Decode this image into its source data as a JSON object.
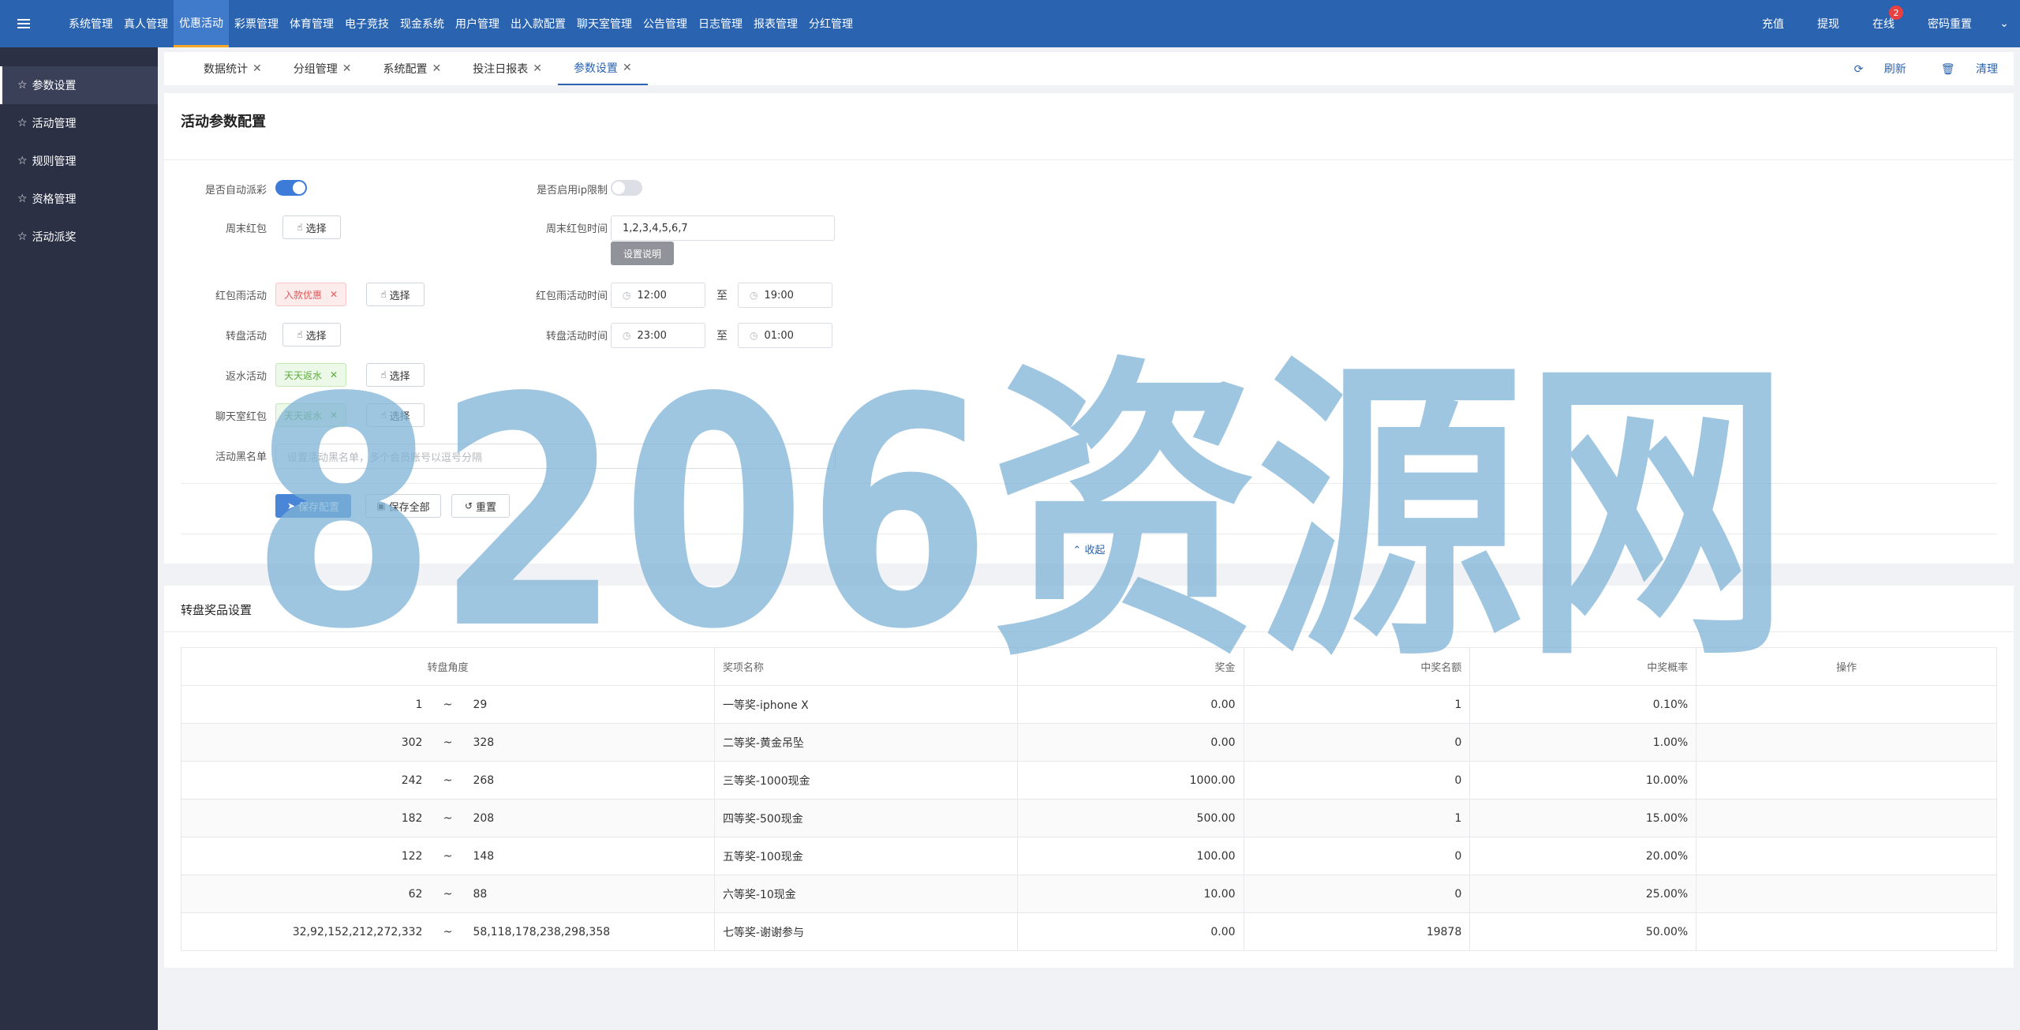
{
  "top_nav": {
    "items": [
      "系统管理",
      "真人管理",
      "优惠活动",
      "彩票管理",
      "体育管理",
      "电子竞技",
      "现金系统",
      "用户管理",
      "出入款配置",
      "聊天室管理",
      "公告管理",
      "日志管理",
      "报表管理",
      "分红管理"
    ],
    "active_index": 2,
    "right_items": {
      "recharge": "充值",
      "withdraw": "提现",
      "online": "在线",
      "online_badge": "2",
      "reset_password": "密码重置"
    }
  },
  "sidebar": {
    "items": [
      "参数设置",
      "活动管理",
      "规则管理",
      "资格管理",
      "活动派奖"
    ],
    "active_index": 0
  },
  "tabs": {
    "items": [
      "数据统计",
      "分组管理",
      "系统配置",
      "投注日报表",
      "参数设置"
    ],
    "active_index": 4,
    "refresh": "刷新",
    "clear": "清理"
  },
  "config": {
    "title": "活动参数配置",
    "auto_award_label": "是否自动派彩",
    "auto_award_on": true,
    "ip_limit_label": "是否启用ip限制",
    "ip_limit_on": false,
    "weekend_label": "周末红包",
    "select_label": "选择",
    "weekend_time_label": "周末红包时间",
    "weekend_time_value": "1,2,3,4,5,6,7",
    "setting_note": "设置说明",
    "rain_label": "红包雨活动",
    "rain_tag": "入款优惠",
    "rain_time_label": "红包雨活动时间",
    "rain_start": "12:00",
    "rain_end": "19:00",
    "to_label": "至",
    "wheel_label": "转盘活动",
    "wheel_time_label": "转盘活动时间",
    "wheel_start": "23:00",
    "wheel_end": "01:00",
    "rebate_label": "返水活动",
    "rebate_tag": "天天返水",
    "chat_label": "聊天室红包",
    "chat_tag": "天天返水",
    "blacklist_label": "活动黑名单",
    "blacklist_placeholder": "设置活动黑名单，多个会员账号以逗号分隔",
    "save_config": "保存配置",
    "save_all": "保存全部",
    "reset": "重置",
    "collapse": "收起"
  },
  "prize": {
    "title": "转盘奖品设置",
    "headers": [
      "转盘角度",
      "奖项名称",
      "奖金",
      "中奖名额",
      "中奖概率",
      "操作"
    ],
    "rows": [
      {
        "angle_from": "1",
        "angle_sep": "~",
        "angle_to": "29",
        "name": "一等奖-iphone X",
        "amount": "0.00",
        "count": "1",
        "rate": "0.10%"
      },
      {
        "angle_from": "302",
        "angle_sep": "~",
        "angle_to": "328",
        "name": "二等奖-黄金吊坠",
        "amount": "0.00",
        "count": "0",
        "rate": "1.00%"
      },
      {
        "angle_from": "242",
        "angle_sep": "~",
        "angle_to": "268",
        "name": "三等奖-1000现金",
        "amount": "1000.00",
        "count": "0",
        "rate": "10.00%"
      },
      {
        "angle_from": "182",
        "angle_sep": "~",
        "angle_to": "208",
        "name": "四等奖-500现金",
        "amount": "500.00",
        "count": "1",
        "rate": "15.00%"
      },
      {
        "angle_from": "122",
        "angle_sep": "~",
        "angle_to": "148",
        "name": "五等奖-100现金",
        "amount": "100.00",
        "count": "0",
        "rate": "20.00%"
      },
      {
        "angle_from": "62",
        "angle_sep": "~",
        "angle_to": "88",
        "name": "六等奖-10现金",
        "amount": "10.00",
        "count": "0",
        "rate": "25.00%"
      },
      {
        "angle_from": "32,92,152,212,272,332",
        "angle_sep": "~",
        "angle_to": "58,118,178,238,298,358",
        "name": "七等奖-谢谢参与",
        "amount": "0.00",
        "count": "19878",
        "rate": "50.00%"
      }
    ]
  },
  "watermark": {
    "text": "8206资源网",
    "color": "#7fb3d5"
  }
}
